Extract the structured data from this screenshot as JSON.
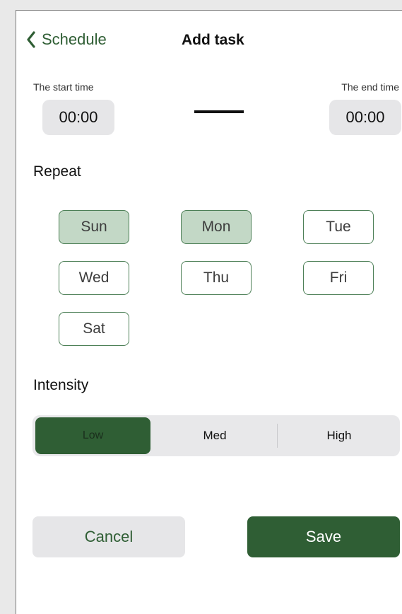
{
  "nav": {
    "back_label": "Schedule",
    "title": "Add task"
  },
  "time": {
    "start_label": "The start time",
    "start_value": "00:00",
    "end_label": "The end time",
    "end_value": "00:00"
  },
  "repeat": {
    "label": "Repeat",
    "days": [
      {
        "label": "Sun",
        "selected": true
      },
      {
        "label": "Mon",
        "selected": true
      },
      {
        "label": "Tue",
        "selected": false
      },
      {
        "label": "Wed",
        "selected": false
      },
      {
        "label": "Thu",
        "selected": false
      },
      {
        "label": "Fri",
        "selected": false
      },
      {
        "label": "Sat",
        "selected": false
      }
    ]
  },
  "intensity": {
    "label": "Intensity",
    "options": [
      "Low",
      "Med",
      "High"
    ],
    "selected": "Low"
  },
  "actions": {
    "cancel_label": "Cancel",
    "save_label": "Save"
  },
  "colors": {
    "accent": "#2f5e34",
    "selected_day_fill": "#c3d8c6",
    "control_background": "#e6e6e8"
  },
  "icons": {
    "back": "chevron-left-icon"
  }
}
